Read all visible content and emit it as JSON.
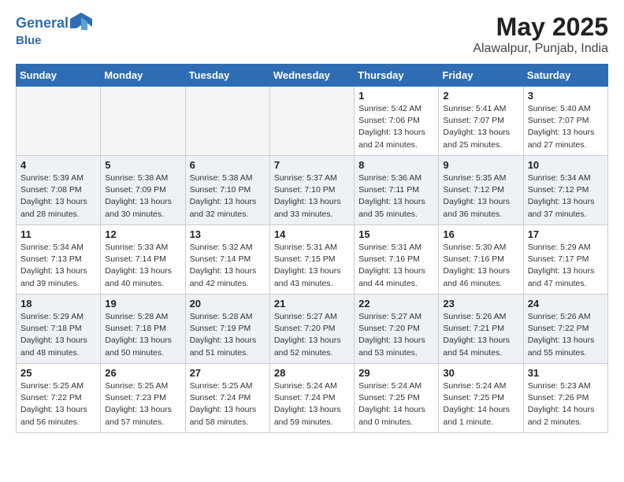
{
  "header": {
    "logo_line1": "General",
    "logo_line2": "Blue",
    "title": "May 2025",
    "subtitle": "Alawalpur, Punjab, India"
  },
  "weekdays": [
    "Sunday",
    "Monday",
    "Tuesday",
    "Wednesday",
    "Thursday",
    "Friday",
    "Saturday"
  ],
  "weeks": [
    [
      {
        "day": "",
        "info": ""
      },
      {
        "day": "",
        "info": ""
      },
      {
        "day": "",
        "info": ""
      },
      {
        "day": "",
        "info": ""
      },
      {
        "day": "1",
        "info": "Sunrise: 5:42 AM\nSunset: 7:06 PM\nDaylight: 13 hours\nand 24 minutes."
      },
      {
        "day": "2",
        "info": "Sunrise: 5:41 AM\nSunset: 7:07 PM\nDaylight: 13 hours\nand 25 minutes."
      },
      {
        "day": "3",
        "info": "Sunrise: 5:40 AM\nSunset: 7:07 PM\nDaylight: 13 hours\nand 27 minutes."
      }
    ],
    [
      {
        "day": "4",
        "info": "Sunrise: 5:39 AM\nSunset: 7:08 PM\nDaylight: 13 hours\nand 28 minutes."
      },
      {
        "day": "5",
        "info": "Sunrise: 5:38 AM\nSunset: 7:09 PM\nDaylight: 13 hours\nand 30 minutes."
      },
      {
        "day": "6",
        "info": "Sunrise: 5:38 AM\nSunset: 7:10 PM\nDaylight: 13 hours\nand 32 minutes."
      },
      {
        "day": "7",
        "info": "Sunrise: 5:37 AM\nSunset: 7:10 PM\nDaylight: 13 hours\nand 33 minutes."
      },
      {
        "day": "8",
        "info": "Sunrise: 5:36 AM\nSunset: 7:11 PM\nDaylight: 13 hours\nand 35 minutes."
      },
      {
        "day": "9",
        "info": "Sunrise: 5:35 AM\nSunset: 7:12 PM\nDaylight: 13 hours\nand 36 minutes."
      },
      {
        "day": "10",
        "info": "Sunrise: 5:34 AM\nSunset: 7:12 PM\nDaylight: 13 hours\nand 37 minutes."
      }
    ],
    [
      {
        "day": "11",
        "info": "Sunrise: 5:34 AM\nSunset: 7:13 PM\nDaylight: 13 hours\nand 39 minutes."
      },
      {
        "day": "12",
        "info": "Sunrise: 5:33 AM\nSunset: 7:14 PM\nDaylight: 13 hours\nand 40 minutes."
      },
      {
        "day": "13",
        "info": "Sunrise: 5:32 AM\nSunset: 7:14 PM\nDaylight: 13 hours\nand 42 minutes."
      },
      {
        "day": "14",
        "info": "Sunrise: 5:31 AM\nSunset: 7:15 PM\nDaylight: 13 hours\nand 43 minutes."
      },
      {
        "day": "15",
        "info": "Sunrise: 5:31 AM\nSunset: 7:16 PM\nDaylight: 13 hours\nand 44 minutes."
      },
      {
        "day": "16",
        "info": "Sunrise: 5:30 AM\nSunset: 7:16 PM\nDaylight: 13 hours\nand 46 minutes."
      },
      {
        "day": "17",
        "info": "Sunrise: 5:29 AM\nSunset: 7:17 PM\nDaylight: 13 hours\nand 47 minutes."
      }
    ],
    [
      {
        "day": "18",
        "info": "Sunrise: 5:29 AM\nSunset: 7:18 PM\nDaylight: 13 hours\nand 48 minutes."
      },
      {
        "day": "19",
        "info": "Sunrise: 5:28 AM\nSunset: 7:18 PM\nDaylight: 13 hours\nand 50 minutes."
      },
      {
        "day": "20",
        "info": "Sunrise: 5:28 AM\nSunset: 7:19 PM\nDaylight: 13 hours\nand 51 minutes."
      },
      {
        "day": "21",
        "info": "Sunrise: 5:27 AM\nSunset: 7:20 PM\nDaylight: 13 hours\nand 52 minutes."
      },
      {
        "day": "22",
        "info": "Sunrise: 5:27 AM\nSunset: 7:20 PM\nDaylight: 13 hours\nand 53 minutes."
      },
      {
        "day": "23",
        "info": "Sunrise: 5:26 AM\nSunset: 7:21 PM\nDaylight: 13 hours\nand 54 minutes."
      },
      {
        "day": "24",
        "info": "Sunrise: 5:26 AM\nSunset: 7:22 PM\nDaylight: 13 hours\nand 55 minutes."
      }
    ],
    [
      {
        "day": "25",
        "info": "Sunrise: 5:25 AM\nSunset: 7:22 PM\nDaylight: 13 hours\nand 56 minutes."
      },
      {
        "day": "26",
        "info": "Sunrise: 5:25 AM\nSunset: 7:23 PM\nDaylight: 13 hours\nand 57 minutes."
      },
      {
        "day": "27",
        "info": "Sunrise: 5:25 AM\nSunset: 7:24 PM\nDaylight: 13 hours\nand 58 minutes."
      },
      {
        "day": "28",
        "info": "Sunrise: 5:24 AM\nSunset: 7:24 PM\nDaylight: 13 hours\nand 59 minutes."
      },
      {
        "day": "29",
        "info": "Sunrise: 5:24 AM\nSunset: 7:25 PM\nDaylight: 14 hours\nand 0 minutes."
      },
      {
        "day": "30",
        "info": "Sunrise: 5:24 AM\nSunset: 7:25 PM\nDaylight: 14 hours\nand 1 minute."
      },
      {
        "day": "31",
        "info": "Sunrise: 5:23 AM\nSunset: 7:26 PM\nDaylight: 14 hours\nand 2 minutes."
      }
    ]
  ]
}
